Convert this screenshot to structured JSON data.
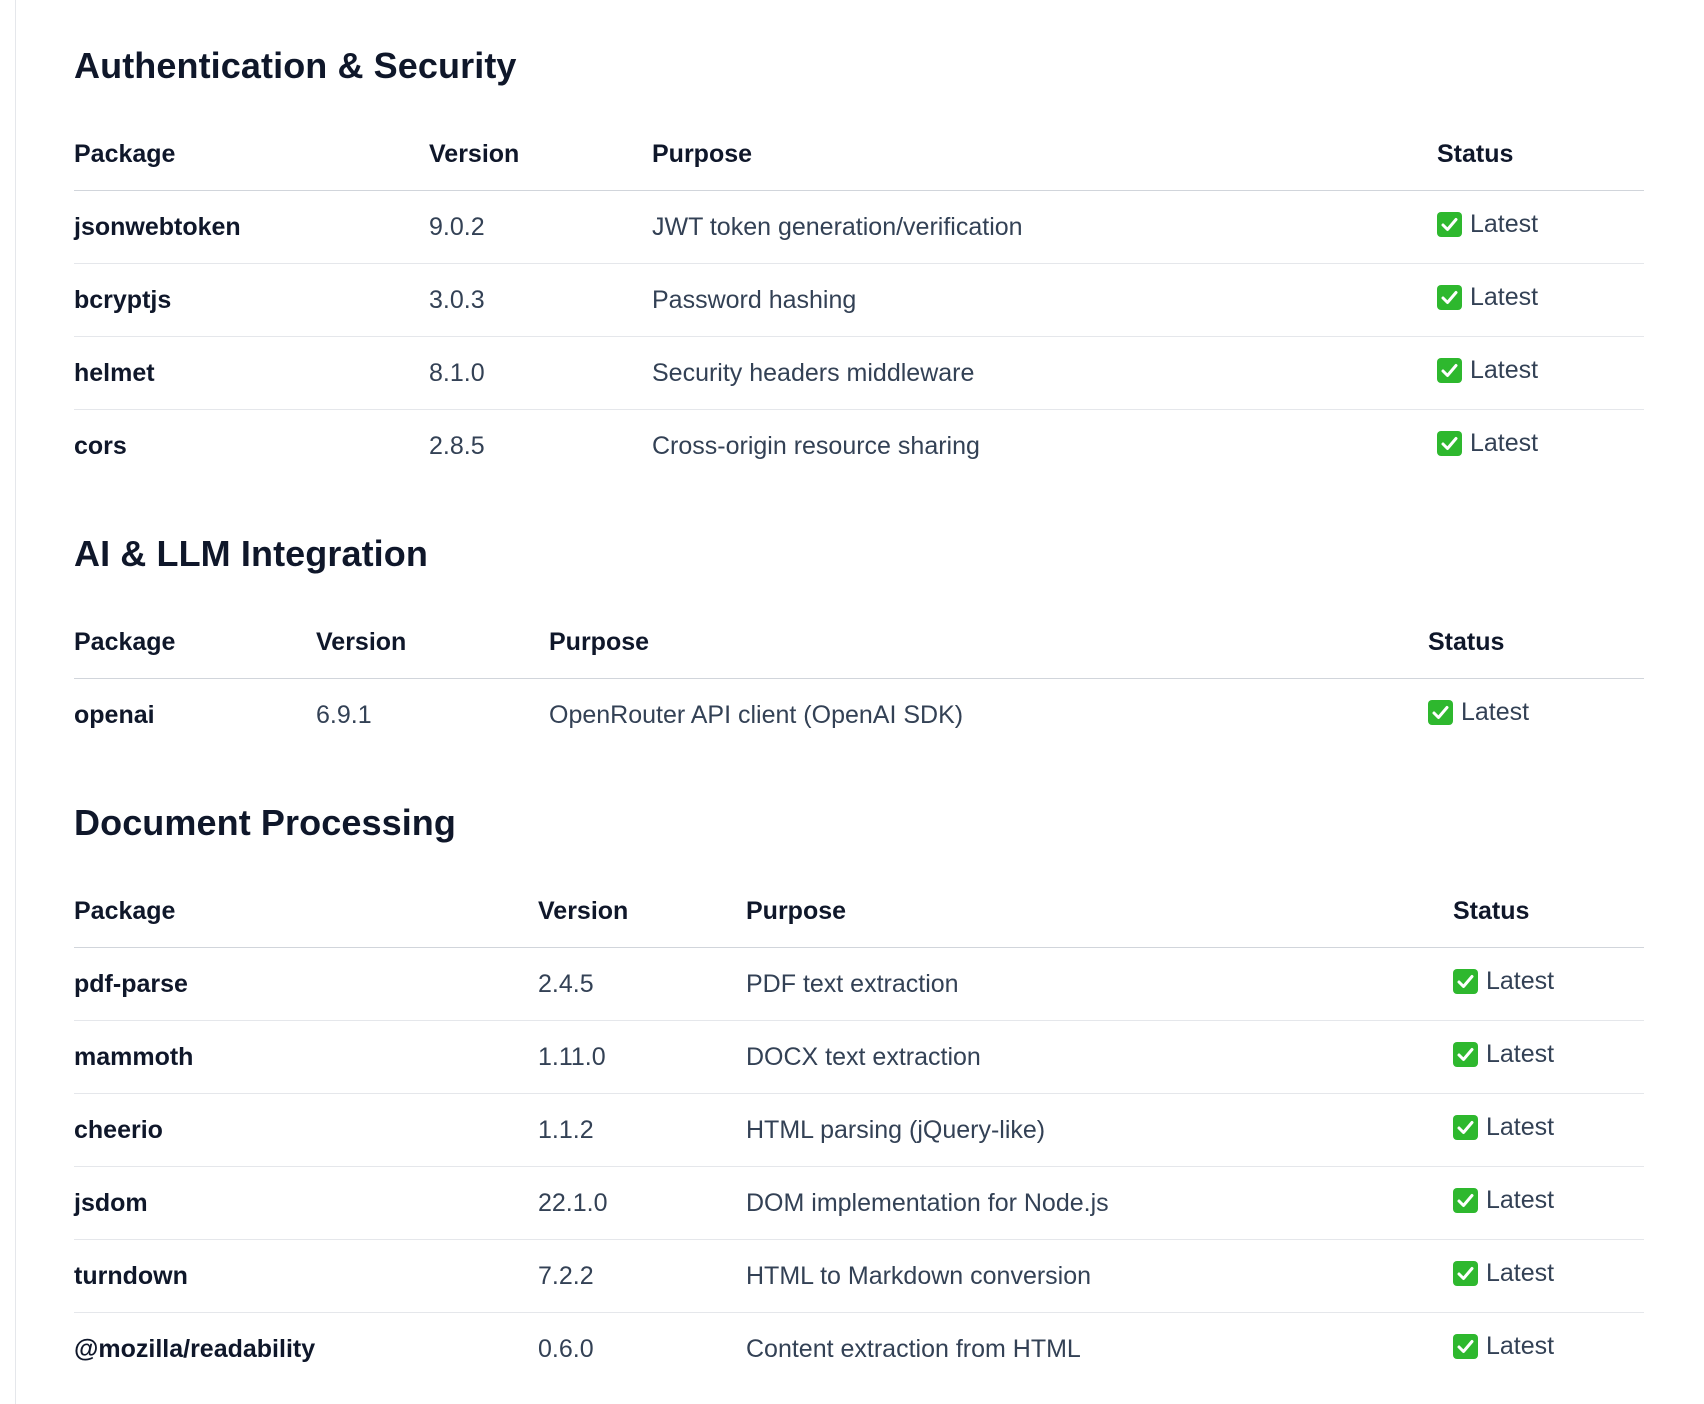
{
  "sections": [
    {
      "title": "Authentication & Security",
      "headers": [
        "Package",
        "Version",
        "Purpose",
        "Status"
      ],
      "rows": [
        {
          "package": "jsonwebtoken",
          "version": "9.0.2",
          "purpose": "JWT token generation/verification",
          "status": "Latest"
        },
        {
          "package": "bcryptjs",
          "version": "3.0.3",
          "purpose": "Password hashing",
          "status": "Latest"
        },
        {
          "package": "helmet",
          "version": "8.1.0",
          "purpose": "Security headers middleware",
          "status": "Latest"
        },
        {
          "package": "cors",
          "version": "2.8.5",
          "purpose": "Cross-origin resource sharing",
          "status": "Latest"
        }
      ]
    },
    {
      "title": "AI & LLM Integration",
      "headers": [
        "Package",
        "Version",
        "Purpose",
        "Status"
      ],
      "rows": [
        {
          "package": "openai",
          "version": "6.9.1",
          "purpose": "OpenRouter API client (OpenAI SDK)",
          "status": "Latest"
        }
      ]
    },
    {
      "title": "Document Processing",
      "headers": [
        "Package",
        "Version",
        "Purpose",
        "Status"
      ],
      "rows": [
        {
          "package": "pdf-parse",
          "version": "2.4.5",
          "purpose": "PDF text extraction",
          "status": "Latest"
        },
        {
          "package": "mammoth",
          "version": "1.11.0",
          "purpose": "DOCX text extraction",
          "status": "Latest"
        },
        {
          "package": "cheerio",
          "version": "1.1.2",
          "purpose": "HTML parsing (jQuery-like)",
          "status": "Latest"
        },
        {
          "package": "jsdom",
          "version": "22.1.0",
          "purpose": "DOM implementation for Node.js",
          "status": "Latest"
        },
        {
          "package": "turndown",
          "version": "7.2.2",
          "purpose": "HTML to Markdown conversion",
          "status": "Latest"
        },
        {
          "package": "@mozilla/readability",
          "version": "0.6.0",
          "purpose": "Content extraction from HTML",
          "status": "Latest"
        }
      ]
    }
  ],
  "colors": {
    "heading": "#0f172a",
    "body_text": "#334155",
    "check_green": "#2eb82e",
    "row_border": "#e5e7eb"
  },
  "icons": {
    "status": "white-check-mark-icon"
  }
}
